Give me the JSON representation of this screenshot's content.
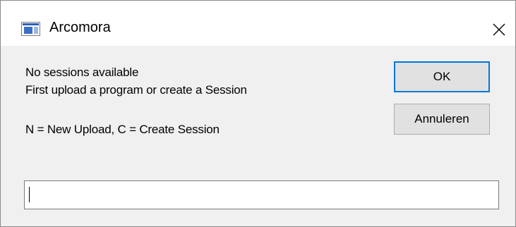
{
  "window": {
    "title": "Arcomora",
    "app_icon": "window-app-icon",
    "close_icon": "close-icon"
  },
  "message": {
    "line1": "No sessions available",
    "line2": "First upload a program or create a Session",
    "line3": "N = New Upload, C = Create Session"
  },
  "buttons": {
    "ok_label": "OK",
    "cancel_label": "Annuleren"
  },
  "input": {
    "value": "",
    "placeholder": ""
  },
  "colors": {
    "background": "#f0f0f0",
    "titlebar": "#ffffff",
    "focus_border": "#0078d7"
  }
}
